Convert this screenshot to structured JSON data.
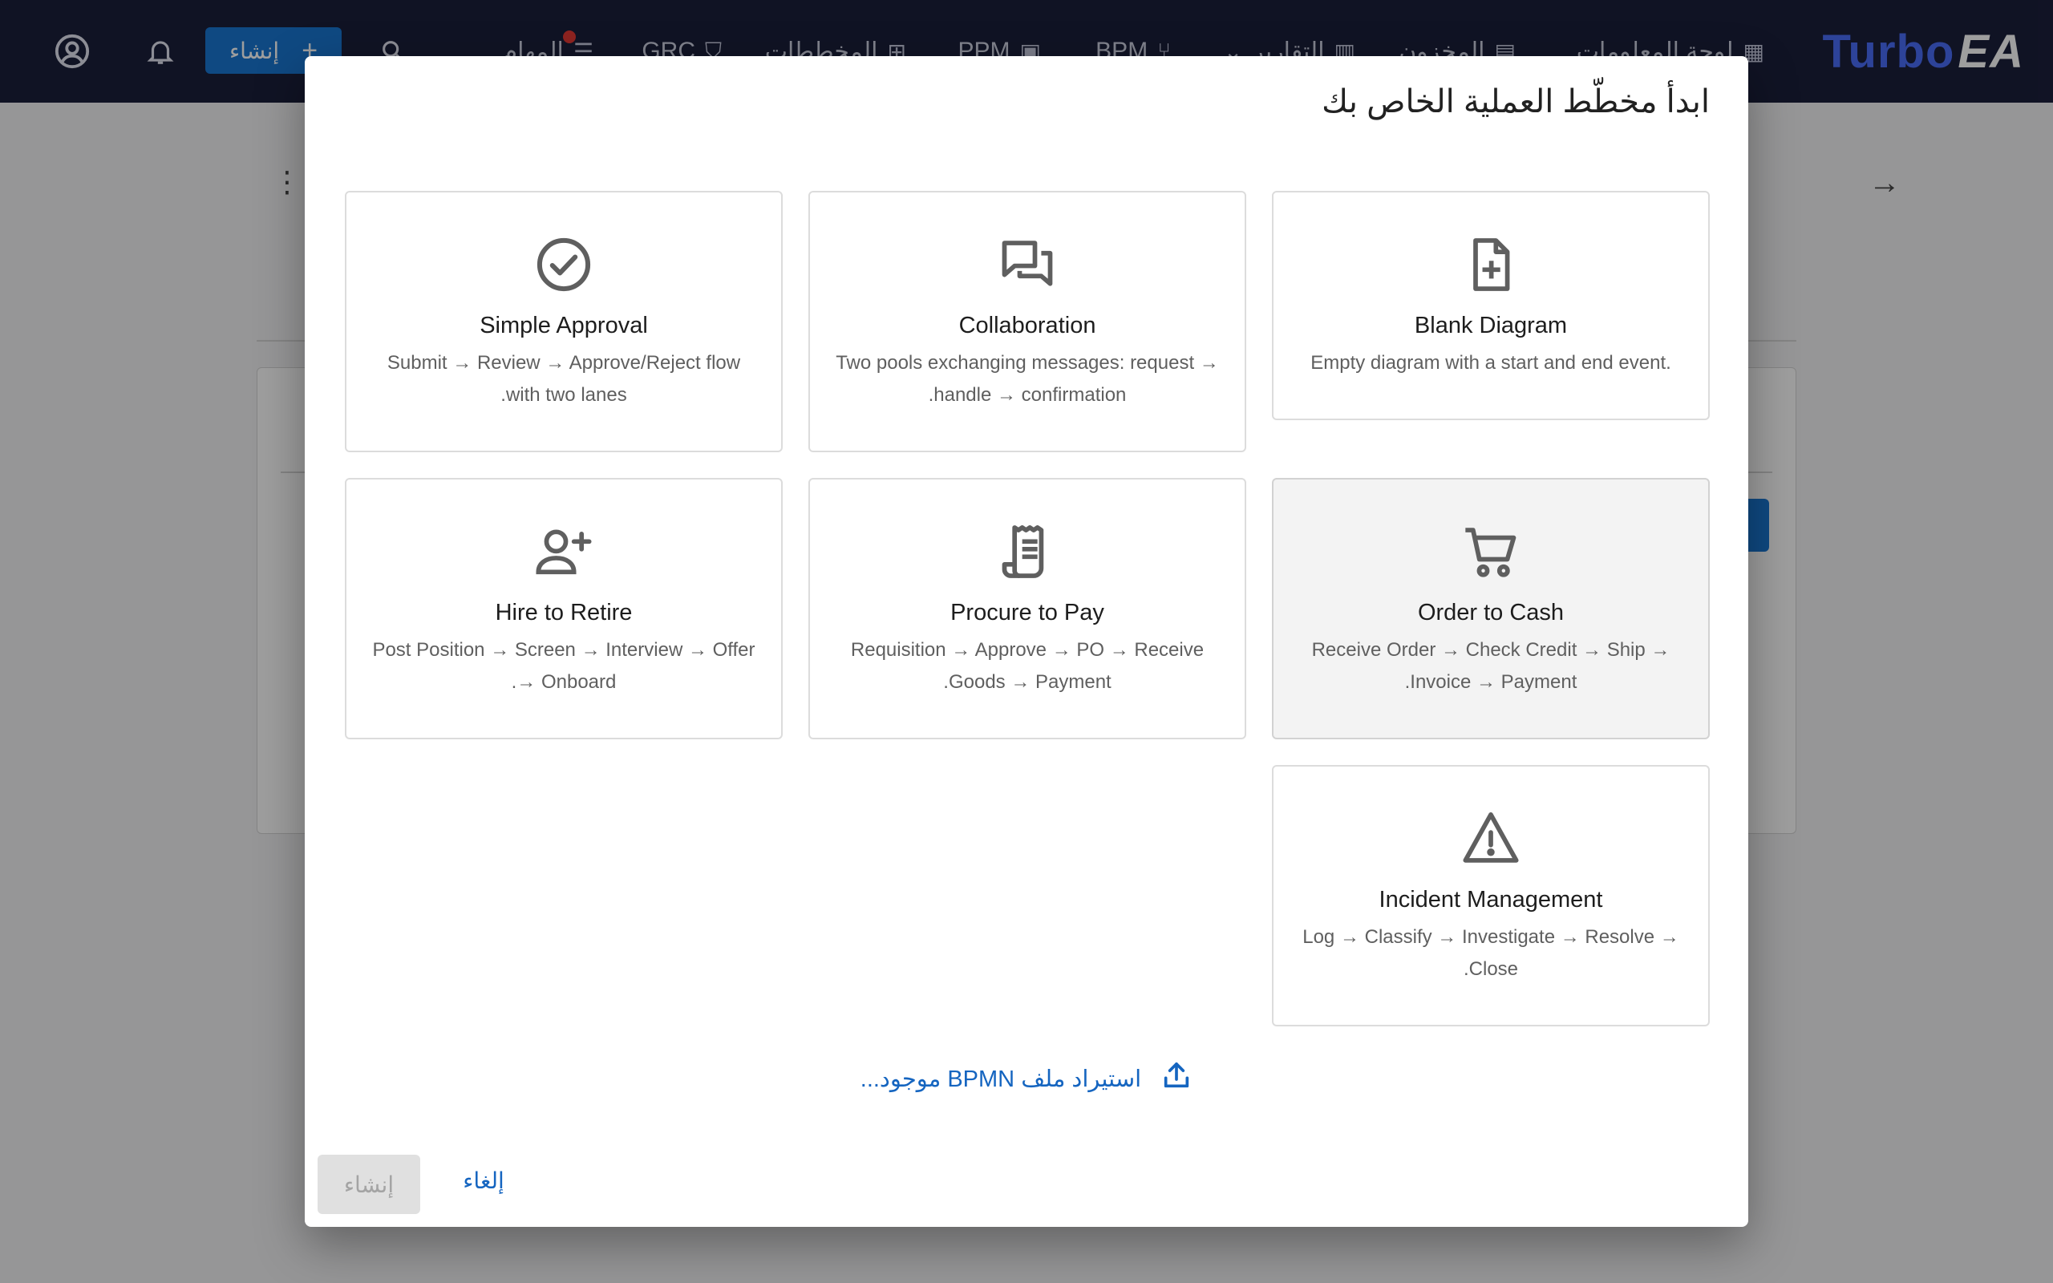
{
  "app": {
    "logo_part1": "Turbo",
    "logo_part2": "EA",
    "nav": [
      {
        "label": "لوحة المعلومات",
        "icon": "dashboard-icon"
      },
      {
        "label": "المخزون",
        "icon": "inventory-icon"
      },
      {
        "label": "التقارير",
        "icon": "reports-icon"
      },
      {
        "label": "BPM",
        "icon": "bpm-icon"
      },
      {
        "label": "PPM",
        "icon": "ppm-icon"
      },
      {
        "label": "المخططات",
        "icon": "diagrams-icon"
      },
      {
        "label": "GRC",
        "icon": "grc-icon"
      },
      {
        "label": "المهام",
        "icon": "tasks-icon"
      }
    ],
    "create_label": "إنشاء"
  },
  "dialog": {
    "title": "ابدأ مخطّط العملية الخاص بك",
    "templates": [
      {
        "title": "Blank Diagram",
        "desc": ".Empty diagram with a start and end event",
        "icon": "file-plus-icon",
        "selected": false
      },
      {
        "title": "Collaboration",
        "desc": "Two pools exchanging messages: request → handle → confirmation.",
        "icon": "chat-bubbles-icon",
        "selected": false
      },
      {
        "title": "Simple Approval",
        "desc": "Submit → Review → Approve/Reject flow with two lanes.",
        "icon": "check-circle-icon",
        "selected": false
      },
      {
        "title": "Order to Cash",
        "desc": "Receive Order → Check Credit → Ship → Invoice → Payment.",
        "icon": "cart-icon",
        "selected": true
      },
      {
        "title": "Procure to Pay",
        "desc": "Requisition → Approve → PO → Receive Goods → Payment.",
        "icon": "receipt-icon",
        "selected": false
      },
      {
        "title": "Hire to Retire",
        "desc": "Post Position → Screen → Interview → Offer → Onboard.",
        "icon": "person-add-icon",
        "selected": false
      },
      {
        "title": "Incident Management",
        "desc": "Log → Classify → Investigate → Resolve → Close.",
        "icon": "warning-icon",
        "selected": false
      }
    ],
    "import_label": "استيراد ملف BPMN موجود...",
    "cancel_label": "إلغاء",
    "create_label": "إنشاء"
  }
}
